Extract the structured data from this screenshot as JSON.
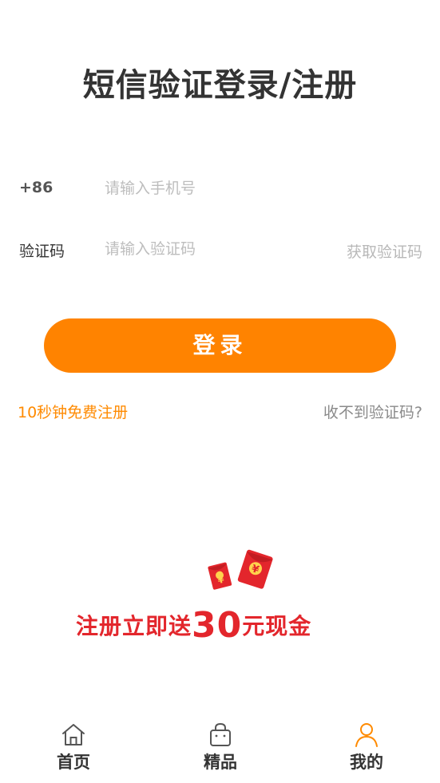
{
  "header": {
    "title": "短信验证登录/注册"
  },
  "form": {
    "phone_prefix": "+86",
    "phone_placeholder": "请输入手机号",
    "phone_value": "",
    "code_label": "验证码",
    "code_placeholder": "请输入验证码",
    "code_value": "",
    "get_code_label": "获取验证码"
  },
  "actions": {
    "login_label": "登录",
    "register_link": "10秒钟免费注册",
    "no_code_link": "收不到验证码?"
  },
  "promo": {
    "text_before": "注册立即送",
    "amount": "30",
    "text_after": "元现金",
    "envelope_symbol": "¥"
  },
  "tabbar": {
    "items": [
      {
        "label": "首页",
        "icon": "home-icon",
        "active": false
      },
      {
        "label": "精品",
        "icon": "bag-icon",
        "active": false
      },
      {
        "label": "我的",
        "icon": "user-icon",
        "active": true
      }
    ]
  },
  "colors": {
    "accent": "#ff8300",
    "promo_red": "#e3262c",
    "tab_active": "#ff8a00",
    "tab_inactive": "#555555"
  }
}
